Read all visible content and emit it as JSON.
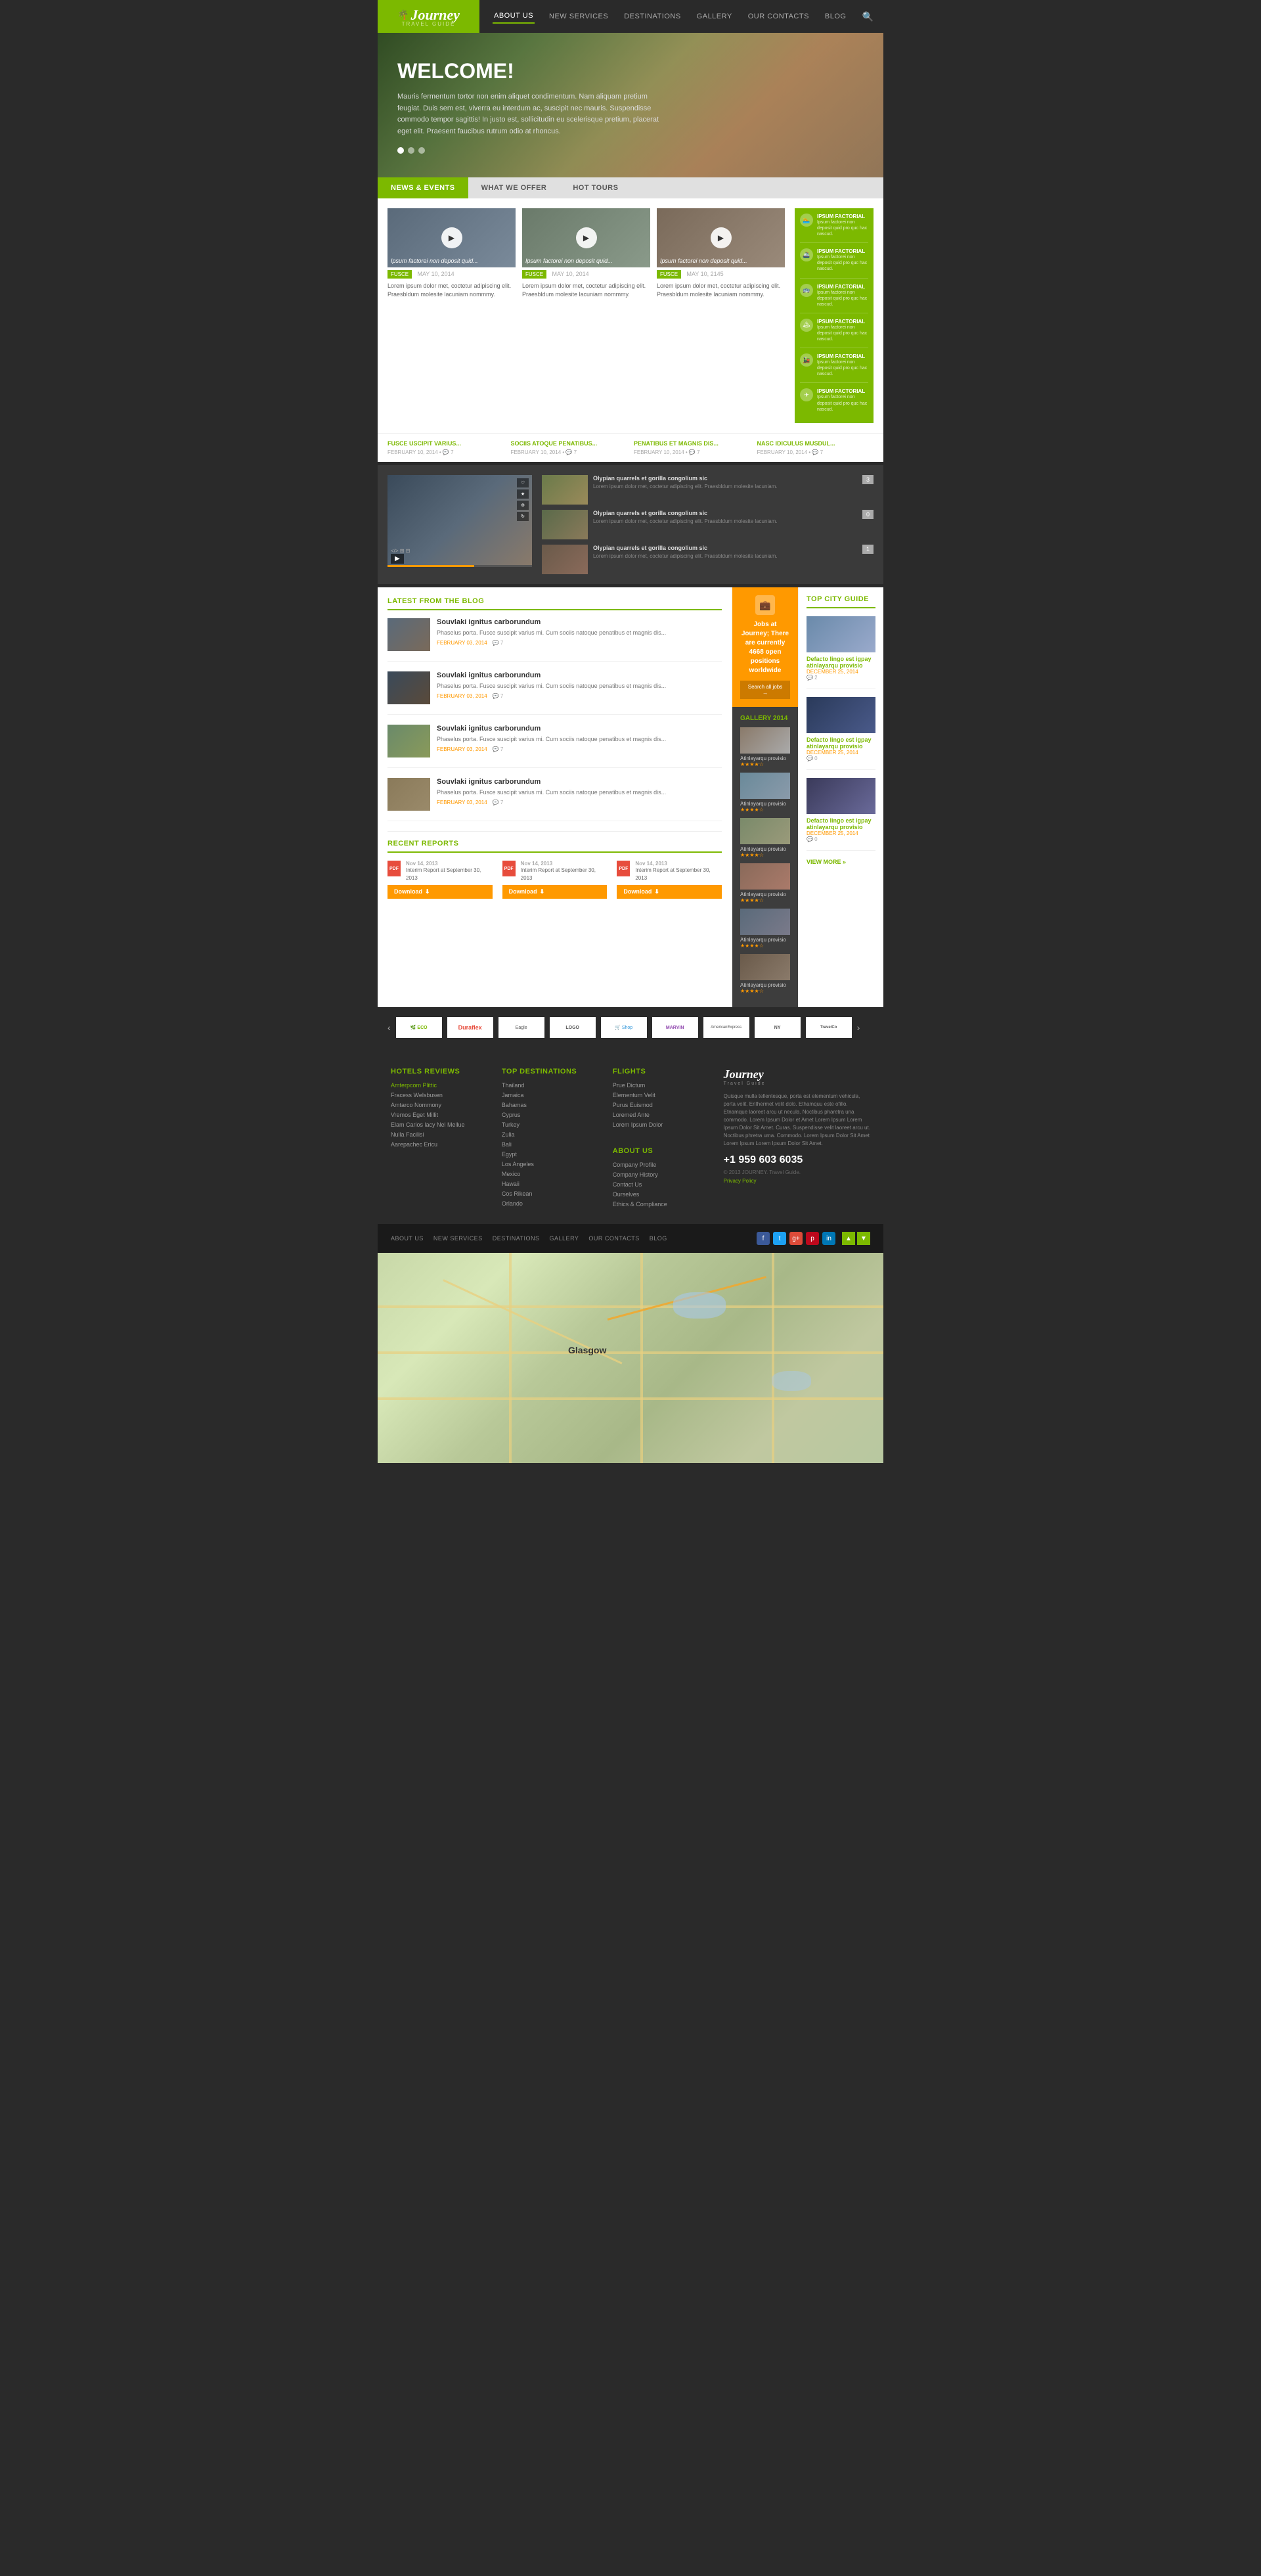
{
  "header": {
    "logo": {
      "name": "Journey",
      "sub": "TRAVEL GUIDE"
    },
    "nav": [
      {
        "label": "ABOUT US",
        "active": true
      },
      {
        "label": "NEW SERVICES",
        "active": false
      },
      {
        "label": "DESTINATIONS",
        "active": false
      },
      {
        "label": "GALLERY",
        "active": false
      },
      {
        "label": "OUR CONTACTS",
        "active": false
      },
      {
        "label": "BLOG",
        "active": false
      }
    ]
  },
  "hero": {
    "title": "WELCOME!",
    "text": "Mauris fermentum tortor non enim aliquet condimentum. Nam aliquam pretium feugiat. Duis sem est, viverra eu interdum ac, suscipit nec mauris. Suspendisse commodo tempor sagittis! In justo est, sollicitudin eu scelerisque pretium, placerat eget elit. Praesent faucibus rutrum odio at rhoncus.",
    "dots": [
      true,
      false,
      false
    ]
  },
  "tabs": [
    {
      "label": "NEWS & EVENTS",
      "active": true
    },
    {
      "label": "WHAT WE OFFER",
      "active": false
    },
    {
      "label": "HOT TOURS",
      "active": false
    }
  ],
  "news_cards": [
    {
      "label": "Ipsum factorei non deposit quid...",
      "tag": "FUSCE",
      "date": "MAY 10, 2014"
    },
    {
      "label": "Ipsum factorei non deposit quid...",
      "tag": "FUSCE",
      "date": "MAY 10, 2014"
    },
    {
      "label": "Ipsum factorei non deposit quid...",
      "tag": "FUSCE",
      "date": "MAY 10, 2145"
    }
  ],
  "news_text": "Lorem ipsum dolor met, coctetur adipiscing elit. Praesbldum molesite lacuniam nommmy.",
  "sidebar_items": [
    {
      "icon": "🏊",
      "title": "IPSUM FACTORIAL",
      "text": "Ipsum factorei non deposit quid pro quc hac nascud."
    },
    {
      "icon": "🚢",
      "title": "IPSUM FACTORIAL",
      "text": "Ipsum factorei non deposit quid pro quc hac nascud."
    },
    {
      "icon": "🚌",
      "title": "IPSUM FACTORIAL",
      "text": "Ipsum factorei non deposit quid pro quc hac nascud."
    },
    {
      "icon": "🏔",
      "title": "IPSUM FACTORIAL",
      "text": "Ipsum factorei non deposit quid pro quc hac nascud."
    },
    {
      "icon": "🚂",
      "title": "IPSUM FACTORIAL",
      "text": "Ipsum factorei non deposit quid pro quc hac nascud."
    },
    {
      "icon": "✈",
      "title": "IPSUM FACTORIAL",
      "text": "Ipsum factorei non deposit quid pro quc hac nascud."
    }
  ],
  "news_links": [
    {
      "title": "FUSCE USCIPIT VARIUS...",
      "date": "FEBRUARY 10, 2014",
      "comments": "7"
    },
    {
      "title": "SOCIIS ATOQUE PENATIBUS...",
      "date": "FEBRUARY 10, 2014",
      "comments": "7"
    },
    {
      "title": "PENATIBUS ET MAGNIS DIS...",
      "date": "FEBRUARY 10, 2014",
      "comments": "7"
    },
    {
      "title": "NASC IDICULUS MUSDUL...",
      "date": "FEBRUARY 10, 2014",
      "comments": "7"
    }
  ],
  "video_items": [
    {
      "title": "Olypian quarrels et gorilla congolium sic",
      "text": "Lorem ipsum dolor met, coctetur adipiscing elit. Praesbldum molesite lacuniam.",
      "count": "3"
    },
    {
      "title": "Olypian quarrels et gorilla congolium sic",
      "text": "Lorem ipsum dolor met, coctetur adipiscing elit. Praesbldum molesite lacuniam.",
      "count": "0"
    },
    {
      "title": "Olypian quarrels et gorilla congolium sic",
      "text": "Lorem ipsum dolor met, coctetur adipiscing elit. Praesbldum molesite lacuniam.",
      "count": "1"
    }
  ],
  "blog": {
    "section_title": "LATEST FROM THE BLOG",
    "items": [
      {
        "title": "Souvlaki ignitus carborundum",
        "text": "Phaselus porta. Fusce suscipit varius mi. Cum sociis natoque penatibus et magnis dis...",
        "date": "FEBRUARY 03, 2014",
        "comments": "7"
      },
      {
        "title": "Souvlaki ignitus carborundum",
        "text": "Phaselus porta. Fusce suscipit varius mi. Cum sociis natoque penatibus et magnis dis...",
        "date": "FEBRUARY 03, 2014",
        "comments": "7"
      },
      {
        "title": "Souvlaki ignitus carborundum",
        "text": "Phaselus porta. Fusce suscipit varius mi. Cum sociis natoque penatibus et magnis dis...",
        "date": "FEBRUARY 03, 2014",
        "comments": "7"
      },
      {
        "title": "Souvlaki ignitus carborundum",
        "text": "Phaselus porta. Fusce suscipit varius mi. Cum sociis natoque penatibus et magnis dis...",
        "date": "FEBRUARY 03, 2014",
        "comments": "7"
      }
    ]
  },
  "jobs": {
    "text": "Jobs at Journey; There are currently 4668 open positions worldwide",
    "button": "Search all jobs →"
  },
  "gallery": {
    "title": "GALLERY 2014",
    "items": [
      {
        "title": "Atinlayarqu provisio",
        "stars": 4
      },
      {
        "title": "Atinlayarqu provisio",
        "stars": 4
      },
      {
        "title": "Atinlayarqu provisio",
        "stars": 4
      },
      {
        "title": "Atinlayarqu provisio",
        "stars": 4
      },
      {
        "title": "Atinlayarqu provisio",
        "stars": 4
      },
      {
        "title": "Atinlayarqu provisio",
        "stars": 4
      }
    ]
  },
  "reports": {
    "section_title": "RECENT REPORTS",
    "items": [
      {
        "date": "Nov 14, 2013",
        "desc": "Interim Report at September 30, 2013"
      },
      {
        "date": "Nov 14, 2013",
        "desc": "Interim Report at September 30, 2013"
      },
      {
        "date": "Nov 14, 2013",
        "desc": "Interim Report at September 30, 2013"
      }
    ],
    "download_label": "Download"
  },
  "top_city": {
    "title": "TOP CITY GUIDE",
    "items": [
      {
        "title": "Defacto lingo est igpay atinlayarqu provisio",
        "date": "DECEMBER 25, 2014",
        "comments": "2"
      },
      {
        "title": "Defacto lingo est igpay atinlayarqu provisio",
        "date": "DECEMBER 25, 2014",
        "comments": "0"
      },
      {
        "title": "Defacto lingo est igpay atinlayarqu provisio",
        "date": "DECEMBER 25, 2014",
        "comments": "0"
      }
    ],
    "view_more": "VIEW MORE »"
  },
  "footer": {
    "hotels": {
      "title": "HOTELS REVIEWS",
      "links": [
        "Amterpcom Plittic",
        "Fracess Welsbusen",
        "Amtarco Nommony",
        "Vremos Eget Millit",
        "Elam Carios lacy Nel Mellue",
        "Nulla Facilisi",
        "Aarepachec Ericu"
      ]
    },
    "destinations": {
      "title": "TOP DESTINATIONS",
      "links": [
        "Thailand",
        "Jamaica",
        "Bahamas",
        "Cyprus",
        "Turkey",
        "Zulia",
        "Bali",
        "Egypt",
        "Los Angeles",
        "Mexico",
        "Hawaii",
        "Cos Rikean",
        "Orlando"
      ]
    },
    "flights": {
      "title": "FLIGHTS",
      "links": [
        "Prue Dictum",
        "Elementum Velit",
        "Purus Euismod",
        "Loremed Ante",
        "Lorem Ipsum Dolor"
      ]
    },
    "about": {
      "title": "ABOUT US",
      "links": [
        "Company Profile",
        "Company History",
        "Contact Us",
        "Ourselves",
        "Ethics & Compliance"
      ]
    },
    "company": {
      "name": "Journey",
      "sub": "Travel Guide",
      "text": "Quisque mulla tellentesque, porta est elementum vehicula, porta velit. Enthermet velit dolo. Ethamquu este ofillo. Etnamque laoreet arcu ut necula. Noctibus pharetra una commodo. Lorem Ipsum Dolor et Amet Lorem Ipsum Lorem Ipsum Dolor Sit Amet. Curas. Suspendisse velit laoreet arcu ut. Noctibus phretra uma. Commodo. Lorem Ipsum Dolor Sit Amet Lorem Ipsum Lorem Ipsum Dolor Sit Amet.",
      "phone": "+1 959 603 6035",
      "copy": "© 2013 JOURNEY. Travel Guide.",
      "privacy": "Privacy Policy"
    }
  },
  "bottom_bar": {
    "nav": [
      "ABOUT US",
      "NEW SERVICES",
      "DESTINATIONS",
      "GALLERY",
      "OUR CONTACTS",
      "BLOG"
    ]
  },
  "brands": [
    "logo1",
    "logo2",
    "logo3",
    "logo4",
    "logo5",
    "logo6",
    "logo7",
    "logo8"
  ],
  "map": {
    "city": "Glasgow"
  }
}
